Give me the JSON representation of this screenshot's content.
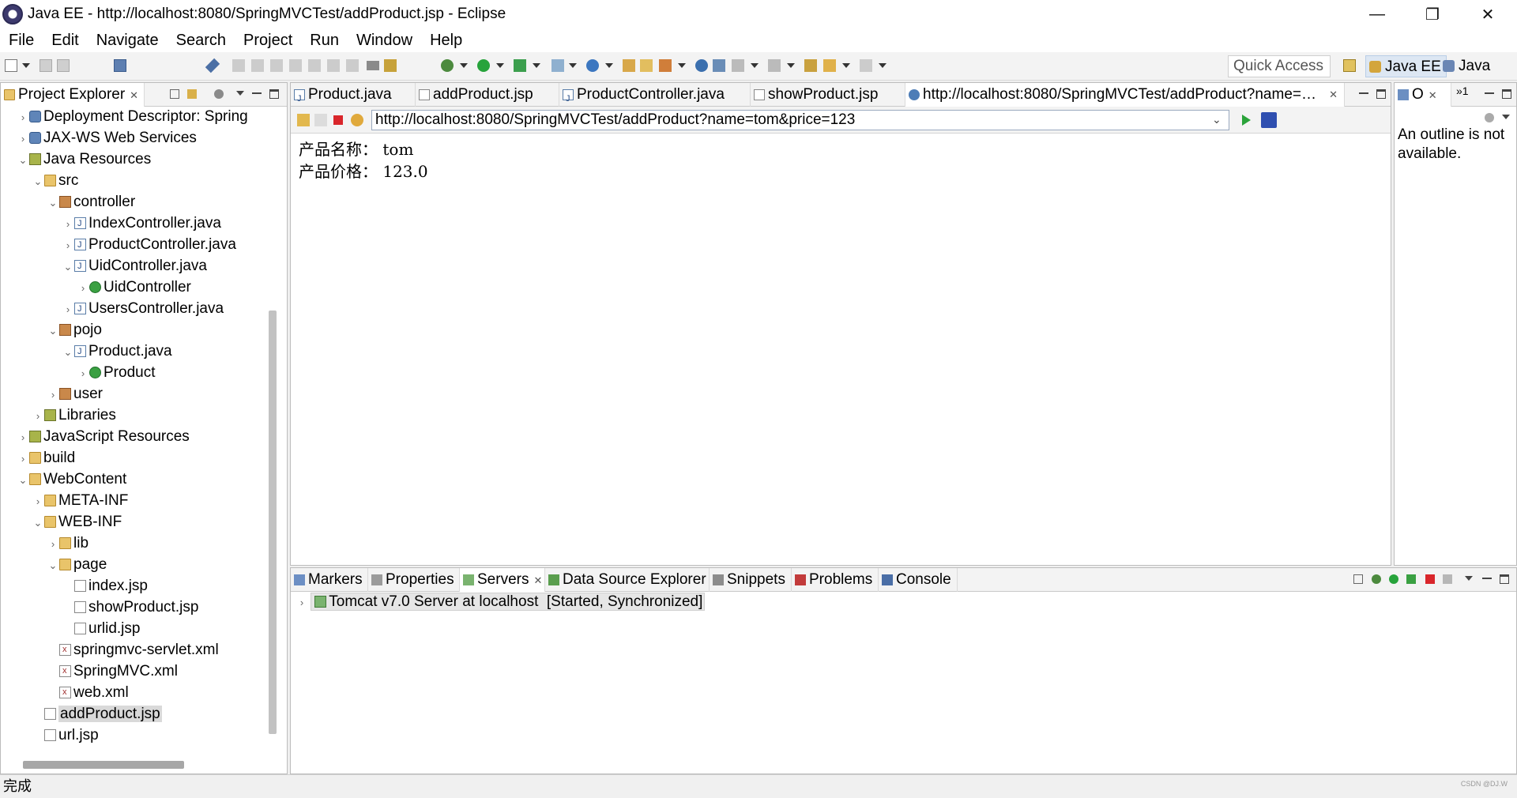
{
  "window": {
    "title": "Java EE - http://localhost:8080/SpringMVCTest/addProduct.jsp - Eclipse",
    "minimize": "—",
    "maximize": "❐",
    "close": "✕"
  },
  "menu": [
    "File",
    "Edit",
    "Navigate",
    "Search",
    "Project",
    "Run",
    "Window",
    "Help"
  ],
  "toolbar": {
    "quick_access": "Quick Access",
    "perspectives": [
      "Java EE",
      "Java"
    ]
  },
  "explorer": {
    "tab_label": "Project Explorer",
    "tree": [
      {
        "label": "Deployment Descriptor: Spring",
        "icon": "web",
        "depth": 0,
        "twisty": "›"
      },
      {
        "label": "JAX-WS Web Services",
        "icon": "web",
        "depth": 0,
        "twisty": "›"
      },
      {
        "label": "Java Resources",
        "icon": "lib",
        "depth": 0,
        "twisty": "⌄"
      },
      {
        "label": "src",
        "icon": "folder",
        "depth": 1,
        "twisty": "⌄"
      },
      {
        "label": "controller",
        "icon": "pkg",
        "depth": 2,
        "twisty": "⌄"
      },
      {
        "label": "IndexController.java",
        "icon": "java",
        "depth": 3,
        "twisty": "›"
      },
      {
        "label": "ProductController.java",
        "icon": "java",
        "depth": 3,
        "twisty": "›"
      },
      {
        "label": "UidController.java",
        "icon": "java",
        "depth": 3,
        "twisty": "⌄"
      },
      {
        "label": "UidController",
        "icon": "class",
        "depth": 4,
        "twisty": "›"
      },
      {
        "label": "UsersController.java",
        "icon": "java",
        "depth": 3,
        "twisty": "›"
      },
      {
        "label": "pojo",
        "icon": "pkg",
        "depth": 2,
        "twisty": "⌄"
      },
      {
        "label": "Product.java",
        "icon": "java",
        "depth": 3,
        "twisty": "⌄"
      },
      {
        "label": "Product",
        "icon": "class",
        "depth": 4,
        "twisty": "›"
      },
      {
        "label": "user",
        "icon": "pkg",
        "depth": 2,
        "twisty": "›"
      },
      {
        "label": "Libraries",
        "icon": "lib",
        "depth": 1,
        "twisty": "›"
      },
      {
        "label": "JavaScript Resources",
        "icon": "lib",
        "depth": 0,
        "twisty": "›"
      },
      {
        "label": "build",
        "icon": "folder",
        "depth": 0,
        "twisty": "›"
      },
      {
        "label": "WebContent",
        "icon": "folder",
        "depth": 0,
        "twisty": "⌄"
      },
      {
        "label": "META-INF",
        "icon": "folder",
        "depth": 1,
        "twisty": "›"
      },
      {
        "label": "WEB-INF",
        "icon": "folder",
        "depth": 1,
        "twisty": "⌄"
      },
      {
        "label": "lib",
        "icon": "folder",
        "depth": 2,
        "twisty": "›"
      },
      {
        "label": "page",
        "icon": "folder",
        "depth": 2,
        "twisty": "⌄"
      },
      {
        "label": "index.jsp",
        "icon": "jsp",
        "depth": 3,
        "twisty": ""
      },
      {
        "label": "showProduct.jsp",
        "icon": "jsp",
        "depth": 3,
        "twisty": ""
      },
      {
        "label": "urlid.jsp",
        "icon": "jsp",
        "depth": 3,
        "twisty": ""
      },
      {
        "label": "springmvc-servlet.xml",
        "icon": "xml",
        "depth": 2,
        "twisty": ""
      },
      {
        "label": "SpringMVC.xml",
        "icon": "xml",
        "depth": 2,
        "twisty": ""
      },
      {
        "label": "web.xml",
        "icon": "xml",
        "depth": 2,
        "twisty": ""
      },
      {
        "label": "addProduct.jsp",
        "icon": "jsp",
        "depth": 1,
        "twisty": "",
        "selected": true
      },
      {
        "label": "url.jsp",
        "icon": "jsp",
        "depth": 1,
        "twisty": ""
      }
    ]
  },
  "editor": {
    "tabs": [
      {
        "label": "Product.java",
        "icon": "java"
      },
      {
        "label": "addProduct.jsp",
        "icon": "jsp"
      },
      {
        "label": "ProductController.java",
        "icon": "java"
      },
      {
        "label": "showProduct.jsp",
        "icon": "jsp"
      },
      {
        "label": "http://localhost:8080/SpringMVCTest/addProduct?name=…",
        "icon": "globe",
        "active": true
      }
    ],
    "url": "http://localhost:8080/SpringMVCTest/addProduct?name=tom&price=123",
    "content": [
      {
        "label": "产品名称：",
        "value": "tom"
      },
      {
        "label": "产品价格：",
        "value": "123.0"
      }
    ]
  },
  "outline": {
    "tab_label": "O",
    "overflow_label": "»1",
    "message_line1": "An outline is not",
    "message_line2": "available."
  },
  "bottom": {
    "tabs": [
      {
        "label": "Markers",
        "icon": "markers"
      },
      {
        "label": "Properties",
        "icon": "properties"
      },
      {
        "label": "Servers",
        "icon": "servers",
        "active": true
      },
      {
        "label": "Data Source Explorer",
        "icon": "datasource"
      },
      {
        "label": "Snippets",
        "icon": "snippets"
      },
      {
        "label": "Problems",
        "icon": "problems"
      },
      {
        "label": "Console",
        "icon": "console"
      }
    ],
    "server": "Tomcat v7.0 Server at localhost  [Started, Synchronized]"
  },
  "status": {
    "text": "完成",
    "watermark": "CSDN @DJ.W"
  }
}
